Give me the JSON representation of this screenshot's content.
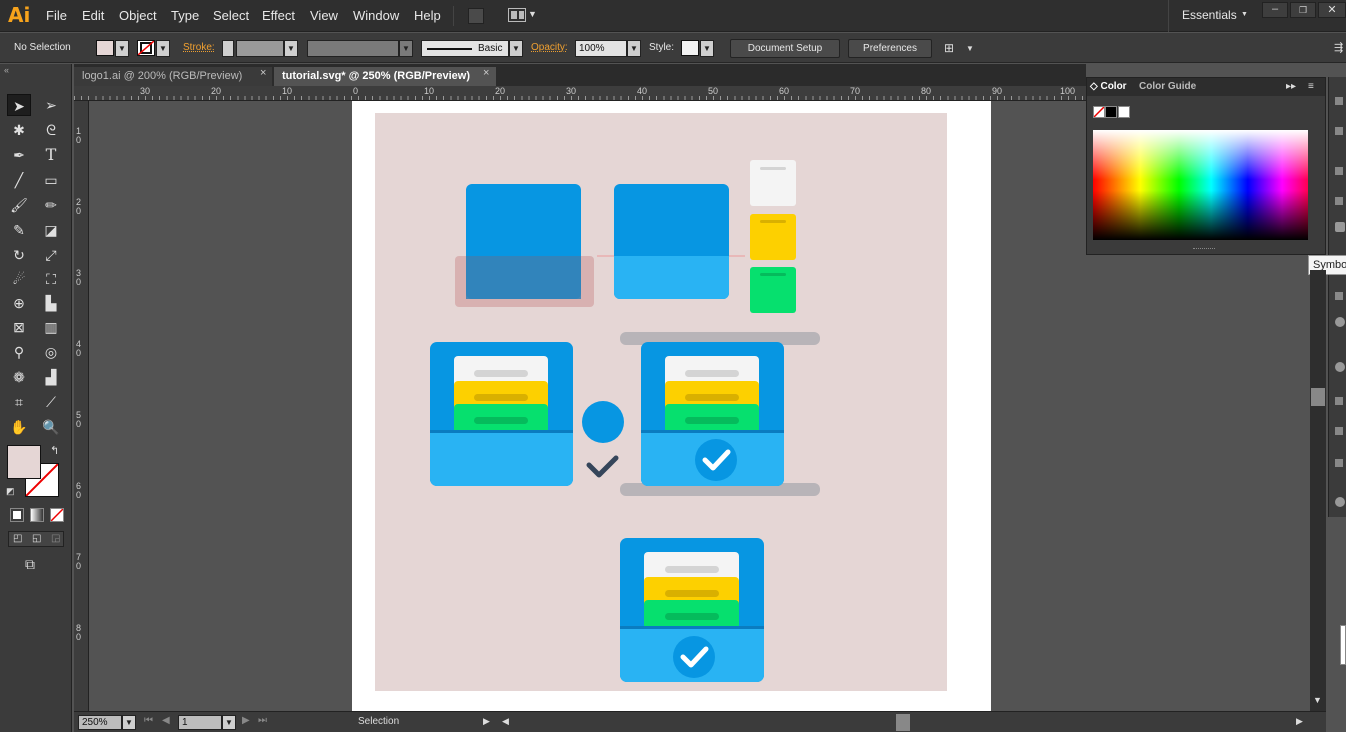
{
  "app": {
    "logo": "Ai",
    "workspace": "Essentials"
  },
  "menu": [
    "File",
    "Edit",
    "Object",
    "Type",
    "Select",
    "Effect",
    "View",
    "Window",
    "Help"
  ],
  "control": {
    "selection": "No Selection",
    "stroke_label": "Stroke:",
    "brush": "Basic",
    "opacity_label": "Opacity:",
    "opacity": "100%",
    "style_label": "Style:",
    "doc_setup": "Document Setup",
    "preferences": "Preferences"
  },
  "tabs": [
    {
      "label": "logo1.ai @ 200% (RGB/Preview)",
      "close": "×"
    },
    {
      "label": "tutorial.svg* @ 250% (RGB/Preview)",
      "close": "×"
    }
  ],
  "ruler_top": [
    "30",
    "20",
    "10",
    "0",
    "10",
    "20",
    "30",
    "40",
    "50",
    "60",
    "70",
    "80",
    "90",
    "100"
  ],
  "ruler_left": [
    "1 0",
    "2 0",
    "3 0",
    "4 0",
    "5 0",
    "6 0",
    "7 0",
    "8 0"
  ],
  "color_panel": {
    "tab_color": "Color",
    "tab_guide": "Color Guide"
  },
  "tooltip": "Symbo",
  "status": {
    "zoom": "250%",
    "page": "1",
    "tool": "Selection"
  },
  "colors": {
    "fill_swatch": "#e5d6d5",
    "artboard_bg": "#e5d6d5",
    "blue": "#0796e2",
    "light_blue": "#29b3f3",
    "yellow": "#fdd000",
    "green": "#06e06e",
    "white_card": "#f4f4f4",
    "check_dark": "#35455a",
    "shadow_gray": "#b8b4b8",
    "pink_shadow": "#d4a8a8"
  },
  "icons": [
    "selection-tool-icon",
    "direct-selection-tool-icon",
    "magic-wand-icon",
    "lasso-icon",
    "pen-icon",
    "type-icon",
    "line-icon",
    "rectangle-icon",
    "paintbrush-icon",
    "pencil-icon",
    "blob-brush-icon",
    "eraser-icon",
    "rotate-icon",
    "scale-icon",
    "warp-icon",
    "free-transform-icon",
    "shape-builder-icon",
    "perspective-icon",
    "mesh-icon",
    "gradient-icon",
    "eyedropper-icon",
    "blend-icon",
    "symbol-sprayer-icon",
    "graph-icon",
    "artboard-icon",
    "slice-icon",
    "hand-icon",
    "zoom-icon"
  ]
}
